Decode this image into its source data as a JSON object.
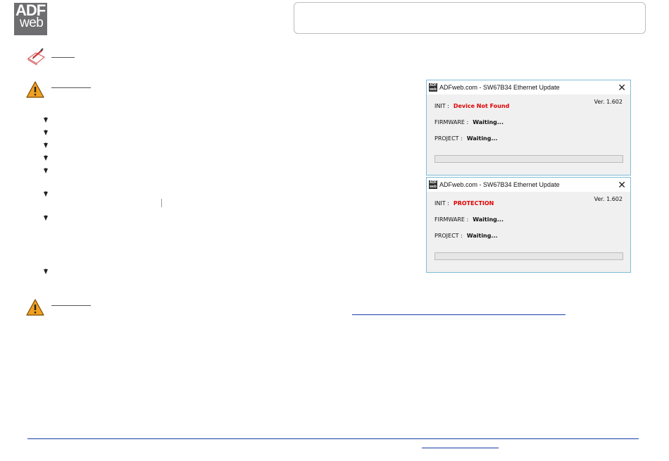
{
  "logo": {
    "line1": "ADF",
    "line2": "web"
  },
  "dialogs": [
    {
      "title": "ADFweb.com - SW67B34 Ethernet Update",
      "app_icon_text": "ADF web",
      "close_glyph": "✕",
      "version": "Ver. 1.602",
      "init_label": "INIT :",
      "init_value": "Device Not Found",
      "firmware_label": "FIRMWARE :",
      "firmware_value": "Waiting...",
      "project_label": "PROJECT :",
      "project_value": "Waiting...",
      "progress": 0
    },
    {
      "title": "ADFweb.com - SW67B34 Ethernet Update",
      "app_icon_text": "ADF web",
      "close_glyph": "✕",
      "version": "Ver. 1.602",
      "init_label": "INIT :",
      "init_value": "PROTECTION",
      "firmware_label": "FIRMWARE :",
      "firmware_value": "Waiting...",
      "project_label": "PROJECT :",
      "project_value": "Waiting...",
      "progress": 0
    }
  ],
  "icons": {
    "note": "note-pencil-icon",
    "warning": "warning-triangle-icon",
    "bullet": "arrow-bullet-icon"
  },
  "colors": {
    "accent_red": "#e00000",
    "link_blue": "#1a3fa8",
    "dialog_border": "#7fbcd7",
    "warning_orange": "#f0a020"
  }
}
